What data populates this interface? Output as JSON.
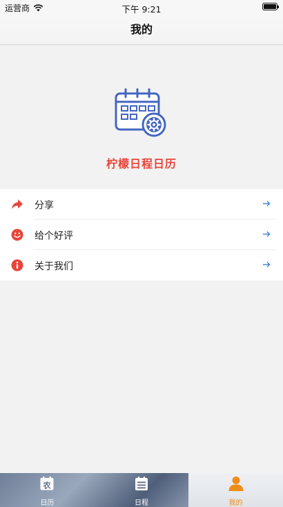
{
  "status_bar": {
    "carrier": "运营商",
    "time": "下午 9:21"
  },
  "nav": {
    "title": "我的"
  },
  "app": {
    "name": "柠檬日程日历"
  },
  "menu": [
    {
      "label": "分享",
      "icon": "share-icon"
    },
    {
      "label": "给个好评",
      "icon": "smile-icon"
    },
    {
      "label": "关于我们",
      "icon": "info-icon"
    }
  ],
  "tabs": [
    {
      "label": "日历",
      "icon": "calendar-icon",
      "glyph": "农"
    },
    {
      "label": "日程",
      "icon": "list-icon"
    },
    {
      "label": "我的",
      "icon": "person-icon",
      "active": true
    }
  ],
  "colors": {
    "accent": "#e8453a",
    "tab_active": "#f08c1a",
    "link_arrow": "#3b82d6"
  }
}
